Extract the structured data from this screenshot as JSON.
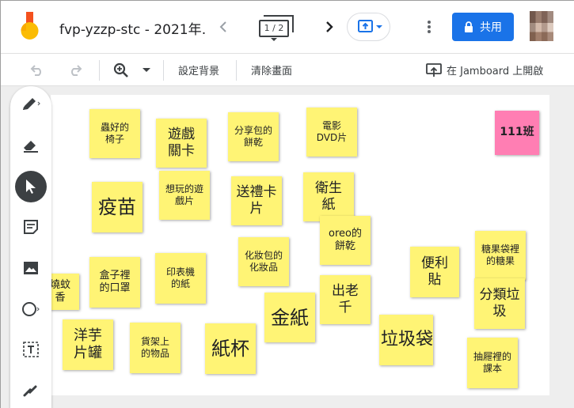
{
  "header": {
    "title": "fvp-yzzp-stc - 2021年…",
    "frame_counter": "1 / 2",
    "share_label": "共用"
  },
  "toolbar": {
    "set_background": "設定背景",
    "clear_frame": "清除畫面",
    "open_in_jamboard": "在 Jamboard 上開啟"
  },
  "sidebar": {
    "tools": [
      "pen-icon",
      "eraser-icon",
      "select-icon",
      "sticky-note-icon",
      "image-icon",
      "circle-icon",
      "text-box-icon",
      "laser-icon"
    ]
  },
  "colors": {
    "note_yellow": "#fff475",
    "note_pink": "#ff7eb3",
    "share_blue": "#1a73e8"
  },
  "notes": [
    {
      "text": "蟲好的\n椅子",
      "color": "yellow"
    },
    {
      "text": "遊戲\n關卡",
      "color": "yellow"
    },
    {
      "text": "分享包的\n餅乾",
      "color": "yellow"
    },
    {
      "text": "電影\nDVD片",
      "color": "yellow"
    },
    {
      "text": "111班",
      "color": "pink"
    },
    {
      "text": "疫苗",
      "color": "yellow"
    },
    {
      "text": "想玩的遊\n戲片",
      "color": "yellow"
    },
    {
      "text": "送禮卡\n片",
      "color": "yellow"
    },
    {
      "text": "衛生\n紙",
      "color": "yellow"
    },
    {
      "text": "oreo的\n餅乾",
      "color": "yellow"
    },
    {
      "text": "化妝包的\n化妝品",
      "color": "yellow"
    },
    {
      "text": "糖果袋裡\n的糖果",
      "color": "yellow"
    },
    {
      "text": "便利\n貼",
      "color": "yellow"
    },
    {
      "text": "燒蚊\n香",
      "color": "yellow"
    },
    {
      "text": "盒子裡\n的口罩",
      "color": "yellow"
    },
    {
      "text": "印表機\n的紙",
      "color": "yellow"
    },
    {
      "text": "出老\n千",
      "color": "yellow"
    },
    {
      "text": "分類垃\n圾",
      "color": "yellow"
    },
    {
      "text": "金紙",
      "color": "yellow"
    },
    {
      "text": "洋芋\n片罐",
      "color": "yellow"
    },
    {
      "text": "貨架上\n的物品",
      "color": "yellow"
    },
    {
      "text": "紙杯",
      "color": "yellow"
    },
    {
      "text": "垃圾袋",
      "color": "yellow"
    },
    {
      "text": "抽屜裡的\n課本",
      "color": "yellow"
    }
  ]
}
